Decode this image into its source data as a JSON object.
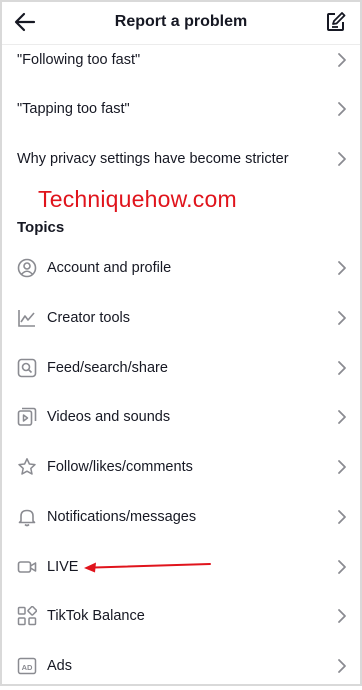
{
  "header": {
    "title": "Report a problem",
    "back_icon": "arrow-left-icon",
    "edit_icon": "edit-note-icon"
  },
  "faq_items": [
    {
      "label": "\"Following too fast\""
    },
    {
      "label": "\"Tapping too fast\""
    },
    {
      "label": "Why privacy settings have become stricter"
    }
  ],
  "watermark": "Techniquehow.com",
  "topics_heading": "Topics",
  "topics": [
    {
      "label": "Account and profile",
      "icon": "account-icon"
    },
    {
      "label": "Creator tools",
      "icon": "chart-line-icon"
    },
    {
      "label": "Feed/search/share",
      "icon": "search-icon"
    },
    {
      "label": "Videos and sounds",
      "icon": "video-icon"
    },
    {
      "label": "Follow/likes/comments",
      "icon": "star-icon"
    },
    {
      "label": "Notifications/messages",
      "icon": "bell-icon"
    },
    {
      "label": "LIVE",
      "icon": "live-camera-icon"
    },
    {
      "label": "TikTok Balance",
      "icon": "grid-icon"
    },
    {
      "label": "Ads",
      "icon": "ad-icon"
    }
  ],
  "colors": {
    "text": "#161823",
    "icon": "#8a8b91",
    "chevron": "#8a8b91",
    "annotation": "#e0141c"
  }
}
